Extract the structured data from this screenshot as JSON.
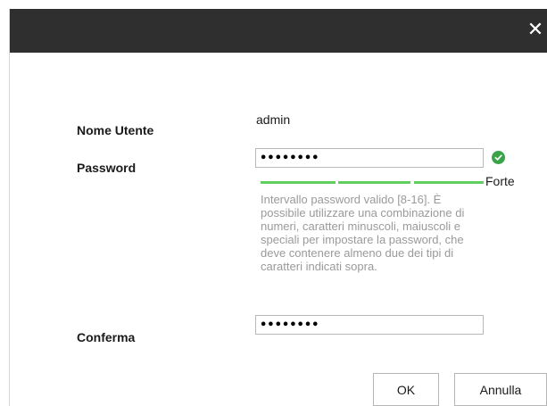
{
  "dialog": {
    "close_glyph": "✕"
  },
  "form": {
    "username_label": "Nome Utente",
    "username_value": "admin",
    "password_label": "Password",
    "password_value": "••••••••",
    "confirm_label": "Conferma",
    "confirm_value": "••••••••",
    "strength_label": "Forte",
    "strength_color": "#5fd05f",
    "valid_icon_color": "#3aa34a",
    "hint": "Intervallo password valido [8-16]. È possibile utilizzare una combinazione di numeri, caratteri minuscoli, maiuscoli e speciali per impostare la password, che deve contenere almeno due dei tipi di caratteri indicati sopra."
  },
  "buttons": {
    "ok_label": "OK",
    "cancel_label": "Annulla"
  }
}
